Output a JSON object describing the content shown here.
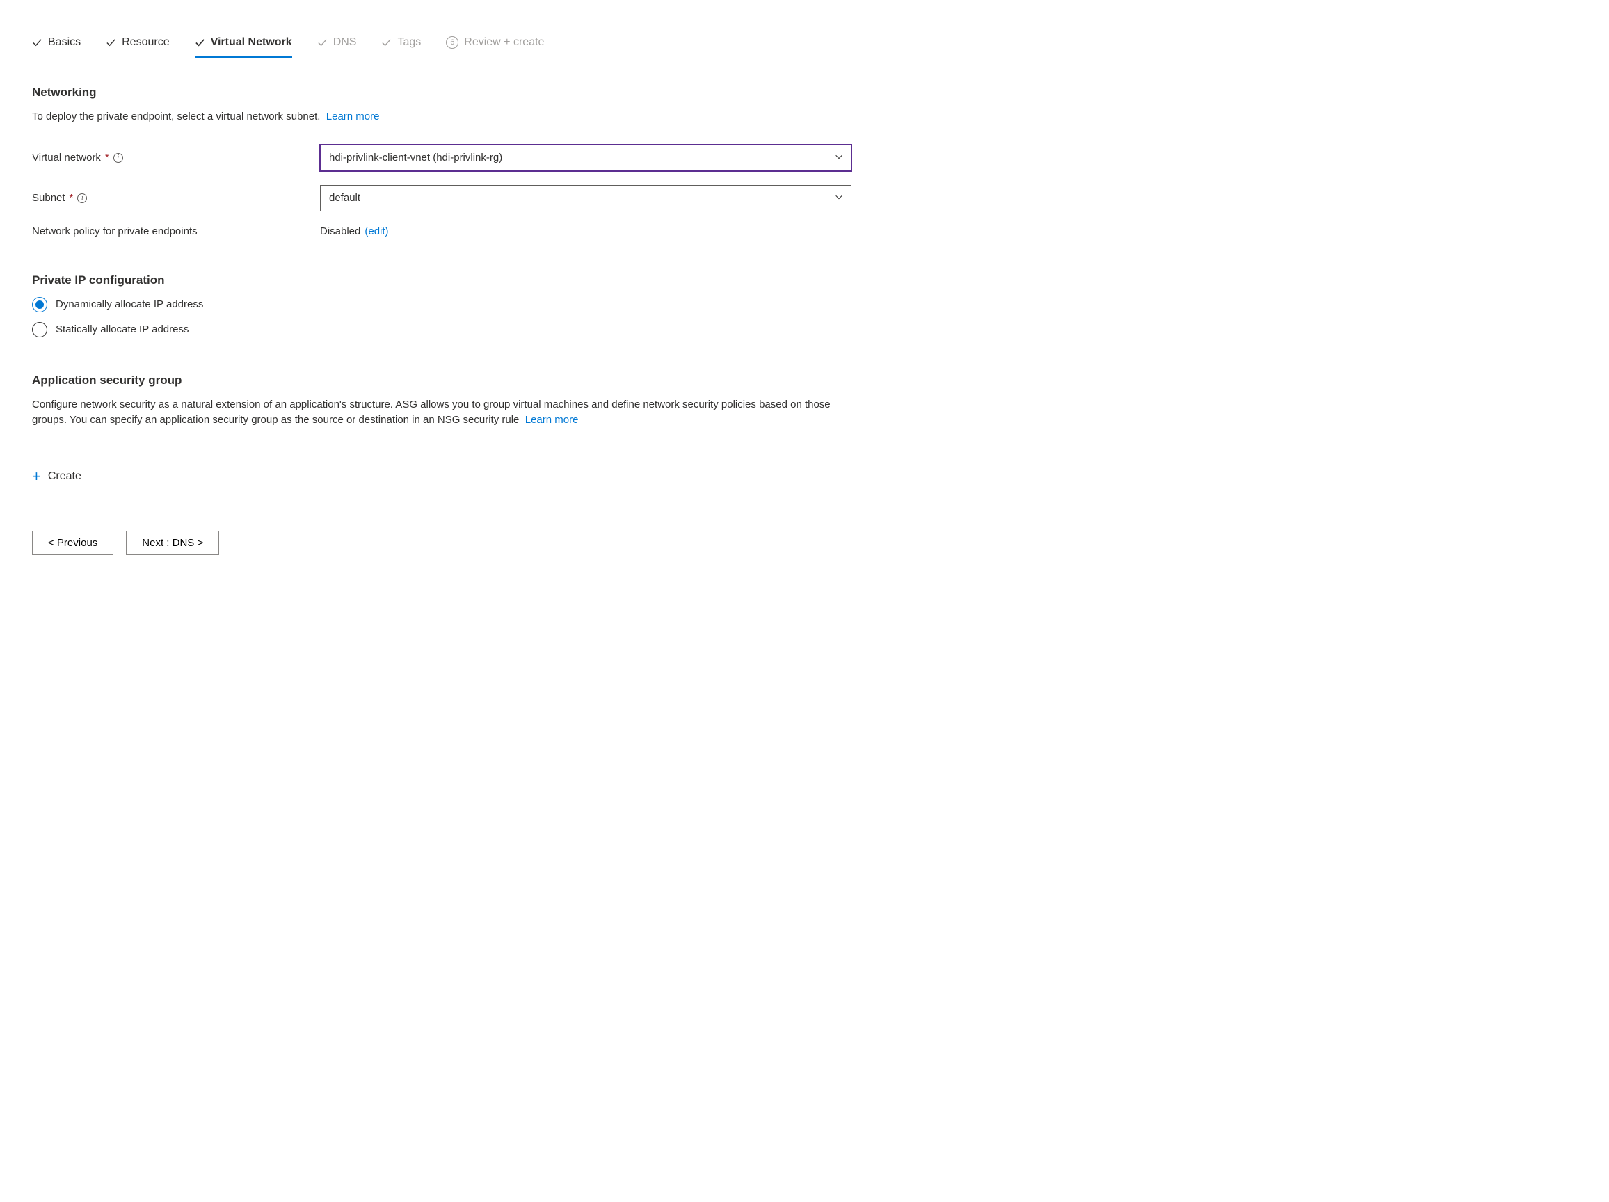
{
  "tabs": {
    "basics": "Basics",
    "resource": "Resource",
    "virtual_network": "Virtual Network",
    "dns": "DNS",
    "tags": "Tags",
    "review": "Review + create",
    "review_num": "6"
  },
  "networking": {
    "title": "Networking",
    "description": "To deploy the private endpoint, select a virtual network subnet.",
    "learn_more": "Learn more",
    "vnet_label": "Virtual network",
    "vnet_value": "hdi-privlink-client-vnet (hdi-privlink-rg)",
    "subnet_label": "Subnet",
    "subnet_value": "default",
    "policy_label": "Network policy for private endpoints",
    "policy_value": "Disabled",
    "policy_edit": "(edit)"
  },
  "ip_config": {
    "title": "Private IP configuration",
    "dynamic": "Dynamically allocate IP address",
    "static": "Statically allocate IP address"
  },
  "asg": {
    "title": "Application security group",
    "description": "Configure network security as a natural extension of an application's structure. ASG allows you to group virtual machines and define network security policies based on those groups. You can specify an application security group as the source or destination in an NSG security rule",
    "learn_more": "Learn more",
    "create": "Create"
  },
  "footer": {
    "previous": "< Previous",
    "next": "Next : DNS >"
  }
}
